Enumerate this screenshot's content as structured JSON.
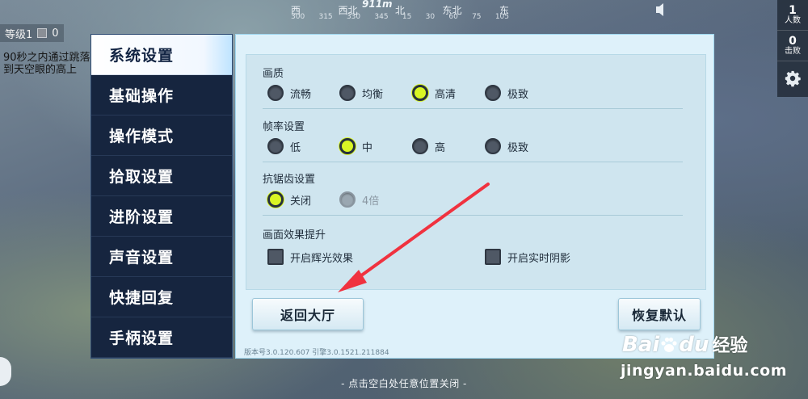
{
  "hud": {
    "distance": "911m",
    "compass_headings": [
      "西",
      "西北",
      "北",
      "东北",
      "东"
    ],
    "compass_numbers": [
      "300",
      "315",
      "330",
      "345",
      "15",
      "30",
      "60",
      "75",
      "105"
    ],
    "level_label": "等级1",
    "level_value": "0",
    "notice": "90秒之内通过跳落到天空眼的高上",
    "players_count": "1",
    "players_label": "人数",
    "kills_count": "0",
    "kills_label": "击败",
    "bottom_hint": "- 点击空白处任意位置关闭 -"
  },
  "sidebar": {
    "items": [
      {
        "label": "系统设置",
        "active": true
      },
      {
        "label": "基础操作"
      },
      {
        "label": "操作模式"
      },
      {
        "label": "拾取设置"
      },
      {
        "label": "进阶设置"
      },
      {
        "label": "声音设置"
      },
      {
        "label": "快捷回复"
      },
      {
        "label": "手柄设置"
      }
    ]
  },
  "settings": {
    "quality": {
      "title": "画质",
      "options": [
        "流畅",
        "均衡",
        "高清",
        "极致"
      ],
      "selected": "高清"
    },
    "framerate": {
      "title": "帧率设置",
      "options": [
        "低",
        "中",
        "高",
        "极致"
      ],
      "selected": "中"
    },
    "antialias": {
      "title": "抗锯齿设置",
      "options": [
        "关闭",
        "4倍"
      ],
      "selected": "关闭",
      "disabled": [
        "4倍"
      ]
    },
    "effects": {
      "title": "画面效果提升",
      "options": [
        "开启辉光效果",
        "开启实时阴影"
      ]
    }
  },
  "buttons": {
    "return_lobby": "返回大厅",
    "restore_default": "恢复默认"
  },
  "version": "版本号3.0.120.607   引擎3.0.1521.211884",
  "watermark": {
    "bai": "Bai",
    "du": "du",
    "cn": "经验",
    "url": "jingyan.baidu.com"
  },
  "colors": {
    "selected_radio": "#d9f524",
    "sidebar_bg": "#16253f",
    "panel_bg": "#def1fa",
    "annotation_arrow": "#f0323f"
  }
}
